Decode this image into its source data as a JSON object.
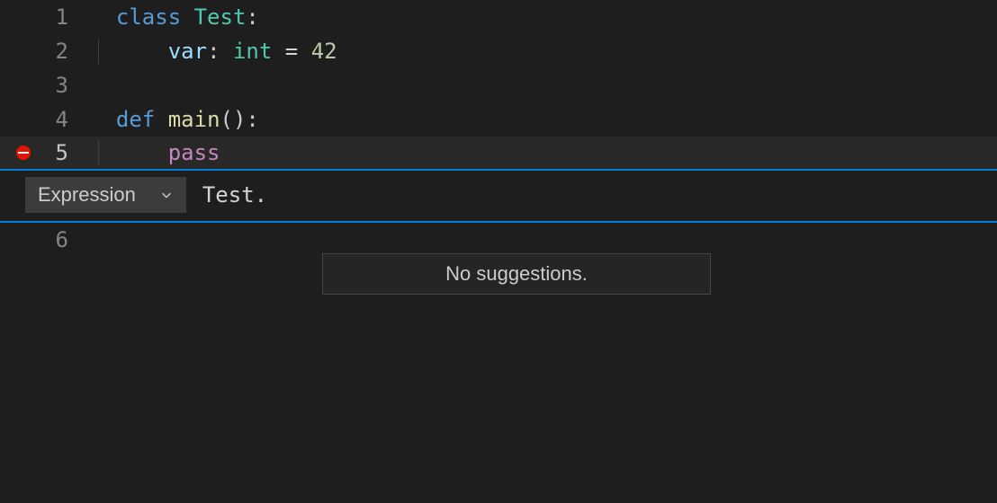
{
  "lines": {
    "l1_num": "1",
    "l2_num": "2",
    "l3_num": "3",
    "l4_num": "4",
    "l5_num": "5",
    "l6_num": "6"
  },
  "code": {
    "kw_class": "class",
    "class_name": "Test",
    "colon": ":",
    "var_name": "var",
    "var_type": "int",
    "eq": " = ",
    "var_val": "42",
    "kw_def": "def",
    "func_name": "main",
    "parens": "()",
    "kw_pass": "pass"
  },
  "debug": {
    "dropdown_label": "Expression",
    "input_value": "Test."
  },
  "popup": {
    "message": "No suggestions."
  }
}
